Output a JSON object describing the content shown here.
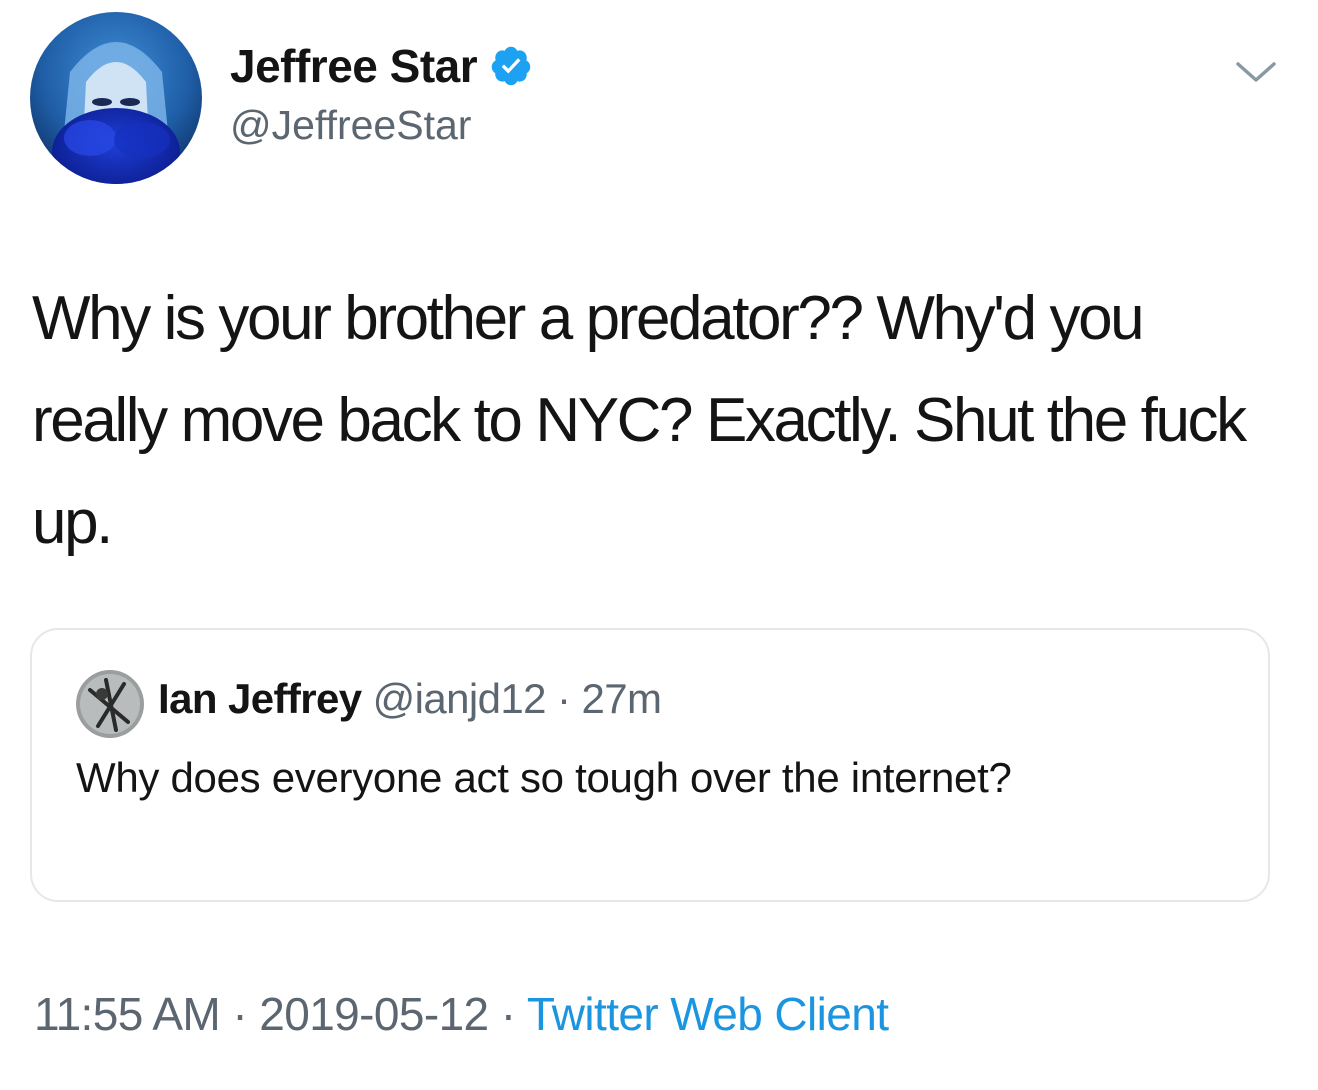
{
  "author": {
    "display_name": "Jeffree Star",
    "handle": "@JeffreeStar",
    "verified_icon": "verified-badge-icon",
    "avatar_icon": "profile-avatar"
  },
  "tweet": {
    "text": "Why is your brother a predator?? Why'd you really move back to NYC? Exactly. Shut the fuck up."
  },
  "quoted_tweet": {
    "display_name": "Ian Jeffrey",
    "handle": "@ianjd12",
    "separator": "·",
    "time": "27m",
    "text": "Why does everyone act so tough over the internet?"
  },
  "footer": {
    "time": "11:55 AM",
    "separator_1": "·",
    "date": "2019-05-12",
    "separator_2": "·",
    "source": "Twitter Web Client"
  },
  "colors": {
    "text_primary": "#141414",
    "text_secondary": "#5b6670",
    "link": "#1b95e0",
    "verified": "#1da1f2",
    "border": "#e4e8ea"
  },
  "icons": {
    "more_menu": "chevron-down-icon"
  }
}
